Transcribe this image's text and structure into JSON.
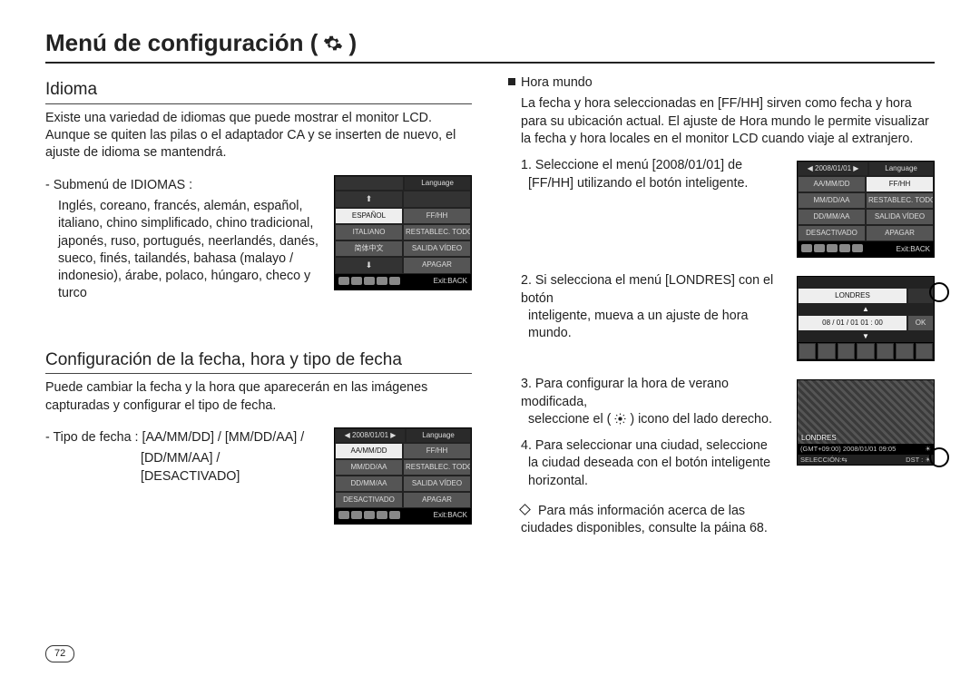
{
  "page_title_prefix": "Menú de configuración (",
  "page_title_suffix": ")",
  "page_number": "72",
  "left": {
    "idioma": {
      "heading": "Idioma",
      "paragraph": "Existe una variedad de idiomas que puede mostrar el monitor LCD. Aunque se quiten las pilas o el adaptador CA y se inserten de nuevo, el ajuste de idioma se mantendrá.",
      "sub_label": "- Submenú de IDIOMAS :",
      "sub_list": "Inglés, coreano, francés, alemán, español, italiano, chino simplificado, chino tradicional, japonés, ruso, portugués, neerlandés, danés, sueco, finés, tailandés, bahasa (malayo / indonesio), árabe, polaco, húngaro, checo y turco",
      "screen": {
        "right_header": "Language",
        "left": [
          "⬆",
          "ESPAÑOL",
          "ITALIANO",
          "简体中文",
          "⬇"
        ],
        "right": [
          "",
          "FF/HH",
          "RESTABLEC. TODO",
          "SALIDA VÍDEO",
          "APAGAR"
        ],
        "footer_right": "Exit:BACK"
      }
    },
    "fecha": {
      "heading": "Configuración de la fecha, hora y tipo de fecha",
      "paragraph": "Puede cambiar la fecha y la hora que aparecerán en las imágenes capturadas y configurar el tipo de fecha.",
      "sub_label": "- Tipo de fecha : [AA/MM/DD] / [MM/DD/AA] /",
      "sub_label2": "[DD/MM/AA] / [DESACTIVADO]",
      "screen": {
        "top_left": "2008/01/01",
        "right_header": "Language",
        "left": [
          "AA/MM/DD",
          "MM/DD/AA",
          "DD/MM/AA",
          "DESACTIVADO"
        ],
        "right": [
          "FF/HH",
          "RESTABLEC. TODO",
          "SALIDA VÍDEO",
          "APAGAR"
        ],
        "footer_right": "Exit:BACK"
      }
    }
  },
  "right": {
    "hora_mundo": {
      "heading": "Hora mundo",
      "paragraph": "La fecha y hora seleccionadas en [FF/HH] sirven como fecha y hora para su ubicación actual. El ajuste de Hora mundo le permite visualizar la fecha y hora locales en el monitor LCD cuando viaje al extranjero.",
      "step1_a": "1. Seleccione el menú [2008/01/01] de",
      "step1_b": "[FF/HH] utilizando el botón inteligente.",
      "screen1": {
        "top_left": "2008/01/01",
        "right_header": "Language",
        "left": [
          "AA/MM/DD",
          "MM/DD/AA",
          "DD/MM/AA",
          "DESACTIVADO"
        ],
        "right": [
          "FF/HH",
          "RESTABLEC. TODO",
          "SALIDA VÍDEO",
          "APAGAR"
        ],
        "footer_right": "Exit:BACK"
      },
      "step2_a": "2. Si selecciona el menú [LONDRES] con el botón",
      "step2_b": "inteligente, mueva a un ajuste de hora mundo.",
      "screen2": {
        "city": "LONDRES",
        "date_row": "08 / 01 / 01 01 : 00",
        "ok": "OK"
      },
      "step3_a": "3. Para configurar la hora de verano modificada,",
      "step3_b": "seleccione el (",
      "step3_c": ") icono del lado derecho.",
      "step4_a": "4. Para seleccionar una ciudad, seleccione",
      "step4_b": "la ciudad deseada con el botón inteligente horizontal.",
      "screen3": {
        "city": "LONDRES",
        "bar": "(GMT+09:00) 2008/01/01 09:05",
        "foot_left": "SELECCIÓN:⇆",
        "foot_right": "DST : ☀"
      },
      "note": "Para más información acerca de las ciudades disponibles, consulte la páina 68."
    }
  }
}
